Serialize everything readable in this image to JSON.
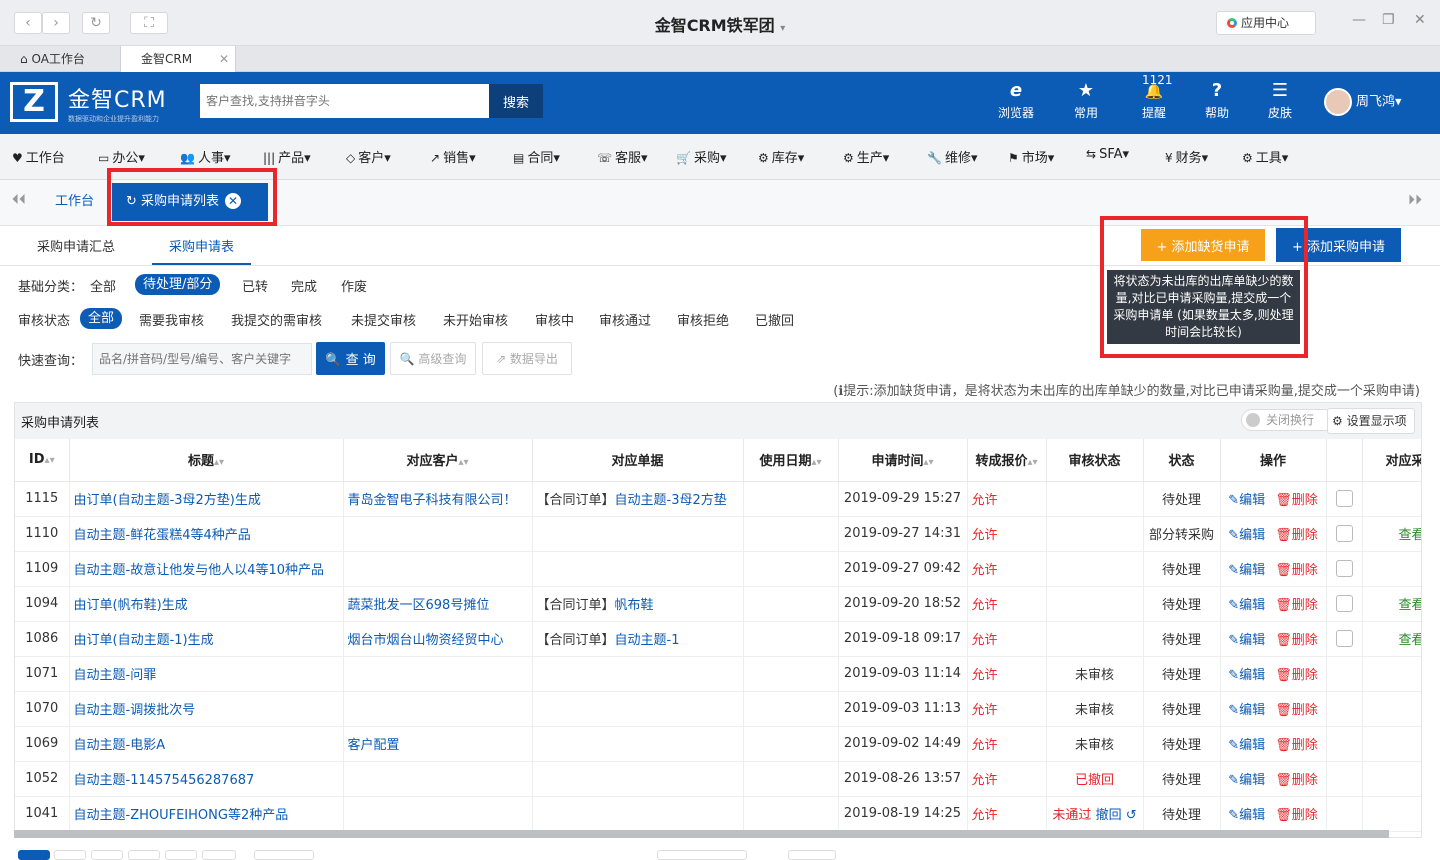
{
  "window": {
    "title": "金智CRM铁军团",
    "title_caret": "▾",
    "app_center": "应用中心",
    "nav_back": "‹",
    "nav_forward": "›",
    "refresh": "↻",
    "fullscreen": "⛶",
    "min": "—",
    "restore": "❐",
    "close": "✕"
  },
  "browser_tabs": [
    {
      "label": "OA工作台",
      "icon": "⌂"
    },
    {
      "label": "金智CRM",
      "close": "✕"
    }
  ],
  "header": {
    "logo_mark": "Z",
    "logo_text": "金智CRM",
    "logo_sub": "数据驱动和企业提升盈利能力",
    "search_placeholder": "客户查找,支持拼音字头",
    "search_btn": "搜索",
    "icons": [
      {
        "name": "browser",
        "label": "浏览器",
        "glyph": "e"
      },
      {
        "name": "common",
        "label": "常用",
        "glyph": "★"
      },
      {
        "name": "remind",
        "label": "提醒",
        "glyph": "🔔",
        "badge": "1121"
      },
      {
        "name": "help",
        "label": "帮助",
        "glyph": "?"
      },
      {
        "name": "skin",
        "label": "皮肤",
        "glyph": "☰"
      }
    ],
    "user": "周飞鸿",
    "user_caret": "▾"
  },
  "menu": [
    {
      "icon": "♥",
      "label": "工作台"
    },
    {
      "icon": "▭",
      "label": "办公▾"
    },
    {
      "icon": "👥",
      "label": "人事▾"
    },
    {
      "icon": "|||",
      "label": "产品▾"
    },
    {
      "icon": "◇",
      "label": "客户▾"
    },
    {
      "icon": "↗",
      "label": "销售▾"
    },
    {
      "icon": "▤",
      "label": "合同▾"
    },
    {
      "icon": "☏",
      "label": "客服▾"
    },
    {
      "icon": "🛒",
      "label": "采购▾"
    },
    {
      "icon": "⚙",
      "label": "库存▾"
    },
    {
      "icon": "⚙",
      "label": "生产▾"
    },
    {
      "icon": "🔧",
      "label": "维修▾"
    },
    {
      "icon": "⚑",
      "label": "市场▾"
    },
    {
      "icon": "⇆",
      "label": "SFA▾"
    },
    {
      "icon": "¥",
      "label": "财务▾"
    },
    {
      "icon": "⚙",
      "label": "工具▾"
    }
  ],
  "tabstrip": {
    "home": "工作台",
    "current": "采购申请列表",
    "current_icon": "↻",
    "close": "✕",
    "left": "⏴⏴",
    "right": "⏵⏵"
  },
  "subtabs": [
    "采购申请汇总",
    "采购申请表"
  ],
  "actions": {
    "add_shortage": "+ 添加缺货申请",
    "add_purchase": "+ 添加采购申请",
    "tooltip": "将状态为未出库的出库单缺少的数量,对比已申请采购量,提交成一个采购申请单 (如果数量太多,则处理时间会比较长)"
  },
  "filters": {
    "basic_label": "基础分类：",
    "basic": [
      "全部",
      "待处理/部分",
      "已转",
      "完成",
      "作废"
    ],
    "audit_label": "审核状态",
    "audit": [
      "全部",
      "需要我审核",
      "我提交的需审核",
      "未提交审核",
      "未开始审核",
      "审核中",
      "审核通过",
      "审核拒绝",
      "已撤回"
    ]
  },
  "query": {
    "label": "快速查询：",
    "placeholder": "品名/拼音码/型号/编号、客户关键字",
    "search": "🔍 查 询",
    "advanced": "🔍 高级查询",
    "export": "⇗ 数据导出"
  },
  "hint": "(ℹ提示:添加缺货申请，是将状态为未出库的出库单缺少的数量,对比已申请采购量,提交成一个采购申请)",
  "table": {
    "title": "采购申请列表",
    "toggle": "关闭换行",
    "settings": "⚙ 设置显示项",
    "sort_glyph": "▴▾",
    "columns": [
      "ID",
      "标题",
      "对应客户",
      "对应单据",
      "使用日期",
      "申请时间",
      "转成报价",
      "审核状态",
      "状态",
      "操作",
      "",
      "对应采购"
    ],
    "edit": "✎编辑",
    "delete": "🗑删除",
    "rows": [
      {
        "id": "1115",
        "title": "由订单(自动主题-3母2方垫)生成",
        "customer": "青岛金智电子科技有限公司！",
        "doc": "【合同订单】",
        "doc_link": "自动主题-3母2方垫",
        "date": "",
        "time": "2019-09-29 15:27",
        "quote": "允许",
        "audit": "",
        "status": "待处理",
        "cb": true,
        "view": ""
      },
      {
        "id": "1110",
        "title": "自动主题-鲜花蛋糕4等4种产品",
        "customer": "",
        "doc": "",
        "doc_link": "",
        "date": "",
        "time": "2019-09-27 14:31",
        "quote": "允许",
        "audit": "",
        "status": "部分转采购",
        "cb": true,
        "view": "查看"
      },
      {
        "id": "1109",
        "title": "自动主题-故意让他发与他人以4等10种产品",
        "customer": "",
        "doc": "",
        "doc_link": "",
        "date": "",
        "time": "2019-09-27 09:42",
        "quote": "允许",
        "audit": "",
        "status": "待处理",
        "cb": true,
        "view": ""
      },
      {
        "id": "1094",
        "title": "由订单(帆布鞋)生成",
        "customer": "蔬菜批发一区698号摊位",
        "doc": "【合同订单】",
        "doc_link": "帆布鞋",
        "date": "",
        "time": "2019-09-20 18:52",
        "quote": "允许",
        "audit": "",
        "status": "待处理",
        "cb": true,
        "view": "查看"
      },
      {
        "id": "1086",
        "title": "由订单(自动主题-1)生成",
        "customer": "烟台市烟台山物资经贸中心",
        "doc": "【合同订单】",
        "doc_link": "自动主题-1",
        "date": "",
        "time": "2019-09-18 09:17",
        "quote": "允许",
        "audit": "",
        "status": "待处理",
        "cb": true,
        "view": "查看"
      },
      {
        "id": "1071",
        "title": "自动主题-问罪",
        "customer": "",
        "doc": "",
        "doc_link": "",
        "date": "",
        "time": "2019-09-03 11:14",
        "quote": "允许",
        "audit": "未审核",
        "status": "待处理",
        "cb": false,
        "view": ""
      },
      {
        "id": "1070",
        "title": "自动主题-调拨批次号",
        "customer": "",
        "doc": "",
        "doc_link": "",
        "date": "",
        "time": "2019-09-03 11:13",
        "quote": "允许",
        "audit": "未审核",
        "status": "待处理",
        "cb": false,
        "view": ""
      },
      {
        "id": "1069",
        "title": "自动主题-电影A",
        "customer": "客户配置",
        "doc": "",
        "doc_link": "",
        "date": "",
        "time": "2019-09-02 14:49",
        "quote": "允许",
        "audit": "未审核",
        "status": "待处理",
        "cb": false,
        "view": ""
      },
      {
        "id": "1052",
        "title": "自动主题-114575456287687",
        "customer": "",
        "doc": "",
        "doc_link": "",
        "date": "",
        "time": "2019-08-26 13:57",
        "quote": "允许",
        "audit": "已撤回",
        "status": "待处理",
        "cb": false,
        "view": ""
      },
      {
        "id": "1041",
        "title": "自动主题-ZHOUFEIHONG等2种产品",
        "customer": "",
        "doc": "",
        "doc_link": "",
        "date": "",
        "time": "2019-08-19 14:25",
        "quote": "允许",
        "audit": "未通过 撤回 ↺",
        "status": "待处理",
        "cb": false,
        "view": ""
      }
    ]
  },
  "colors": {
    "brand": "#0c5bb4",
    "orange": "#f7a019",
    "red": "#e8262c",
    "green": "#2a8a2a",
    "highlight": "#e8262c"
  }
}
